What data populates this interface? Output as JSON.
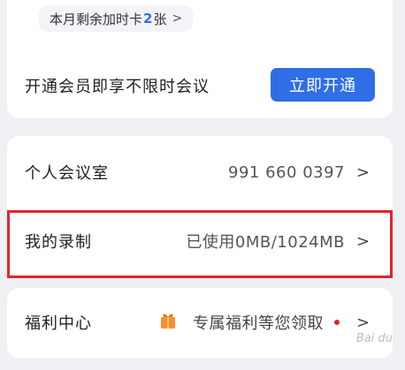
{
  "membership": {
    "addtime_prefix": "本月剩余加时卡",
    "addtime_count": "2",
    "addtime_suffix": "张",
    "promo_text": "开通会员即享不限时会议",
    "open_button": "立即开通"
  },
  "list": {
    "personal_room_label": "个人会议室",
    "personal_room_value": "991 660 0397",
    "recording_label": "我的录制",
    "recording_value": "已使用0MB/1024MB"
  },
  "benefits": {
    "label": "福利中心",
    "value": "专属福利等您领取"
  },
  "watermark": "Bai du",
  "icons": {
    "chevron": "chevron-right-icon",
    "gift": "gift-icon"
  },
  "colors": {
    "accent": "#2f6ee6",
    "highlight": "#e0262b"
  }
}
